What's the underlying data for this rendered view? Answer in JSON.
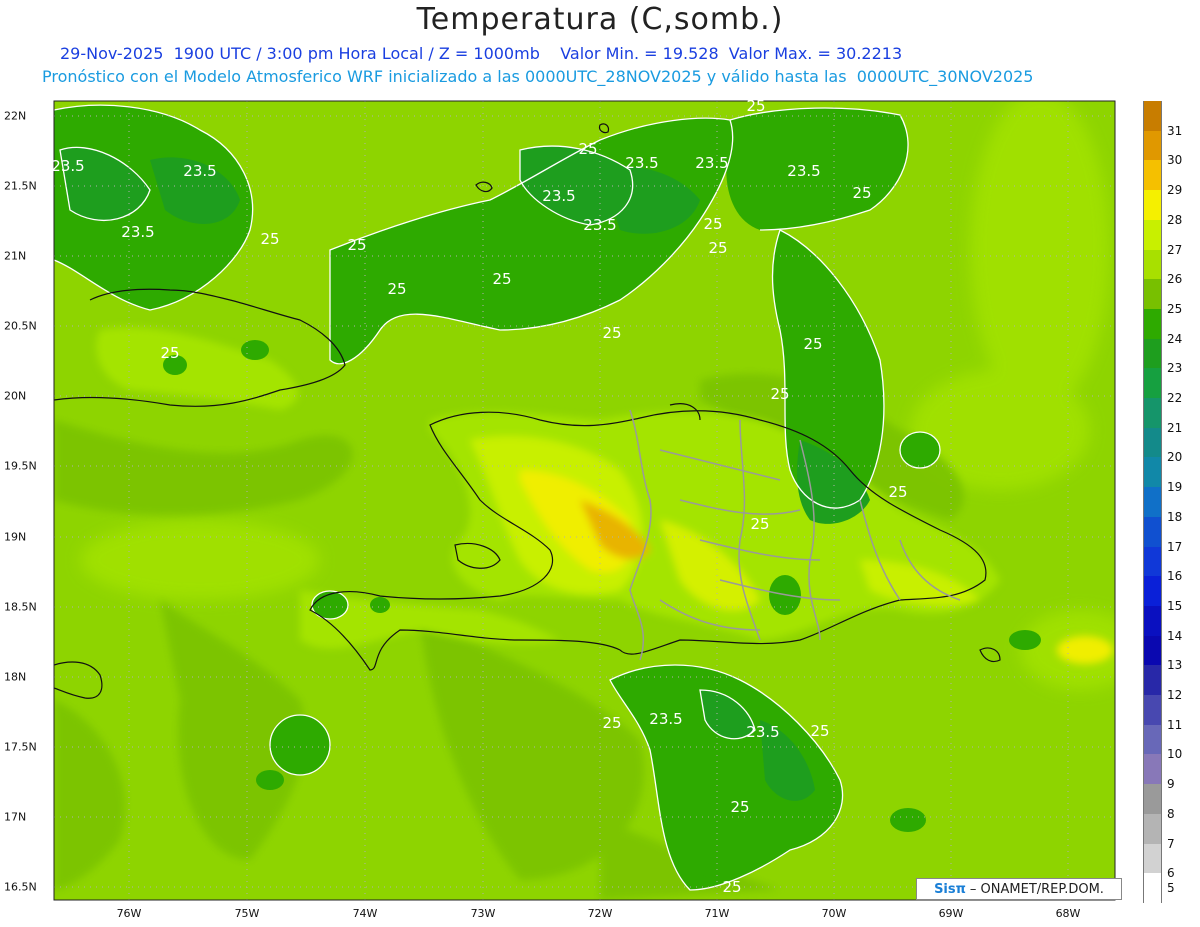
{
  "header": {
    "title": "Temperatura (C,somb.)",
    "line1": "29-Nov-2025  1900 UTC / 3:00 pm Hora Local / Z = 1000mb    Valor Min. = 19.528  Valor Max. = 30.2213",
    "line2": "Pronóstico con el Modelo Atmosferico WRF inicializado a las 0000UTC_28NOV2025 y válido hasta las  0000UTC_30NOV2025"
  },
  "axes": {
    "lat_labels": [
      "22N",
      "21.5N",
      "21N",
      "20.5N",
      "20N",
      "19.5N",
      "19N",
      "18.5N",
      "18N",
      "17.5N",
      "17N",
      "16.5N"
    ],
    "lon_labels": [
      "76W",
      "75W",
      "74W",
      "73W",
      "72W",
      "71W",
      "70W",
      "69W",
      "68W"
    ]
  },
  "colorbar": {
    "labels": [
      "31",
      "30",
      "29",
      "28",
      "27",
      "26",
      "25",
      "24",
      "23",
      "22",
      "21",
      "20",
      "19",
      "18",
      "17",
      "16",
      "15",
      "14",
      "13",
      "12",
      "11",
      "10",
      "9",
      "8",
      "7",
      "6",
      "5"
    ],
    "colors": [
      "#c87d00",
      "#e09800",
      "#f5c000",
      "#f5f000",
      "#c8f000",
      "#a8e000",
      "#78c000",
      "#2eaa00",
      "#1e9e1e",
      "#16a040",
      "#15956a",
      "#138a8a",
      "#1188a8",
      "#1070c8",
      "#1050d0",
      "#1038d8",
      "#0a20d8",
      "#0a10c0",
      "#0a08b0",
      "#2828a8",
      "#4848b0",
      "#6868b8",
      "#8878b8",
      "#9a9a9a",
      "#b4b4b4",
      "#d2d2d2",
      "#ffffff"
    ]
  },
  "contour_labels": [
    {
      "text": "23.5"
    },
    {
      "text": "23.5"
    },
    {
      "text": "23.5"
    },
    {
      "text": "25"
    },
    {
      "text": "25"
    },
    {
      "text": "25"
    },
    {
      "text": "25"
    },
    {
      "text": "25"
    },
    {
      "text": "25"
    },
    {
      "text": "23.5"
    },
    {
      "text": "23.5"
    },
    {
      "text": "23.5"
    },
    {
      "text": "25"
    },
    {
      "text": "25"
    },
    {
      "text": "23.5"
    },
    {
      "text": "23.5"
    },
    {
      "text": "25"
    },
    {
      "text": "25"
    },
    {
      "text": "25"
    },
    {
      "text": "25"
    },
    {
      "text": "25"
    },
    {
      "text": "25"
    },
    {
      "text": "25"
    },
    {
      "text": "23.5"
    },
    {
      "text": "23.5"
    },
    {
      "text": "25"
    },
    {
      "text": "25"
    },
    {
      "text": "25"
    },
    {
      "text": "25"
    }
  ],
  "credit": {
    "logo": "Sisπ",
    "text": "– ONAMET/REP.DOM."
  }
}
